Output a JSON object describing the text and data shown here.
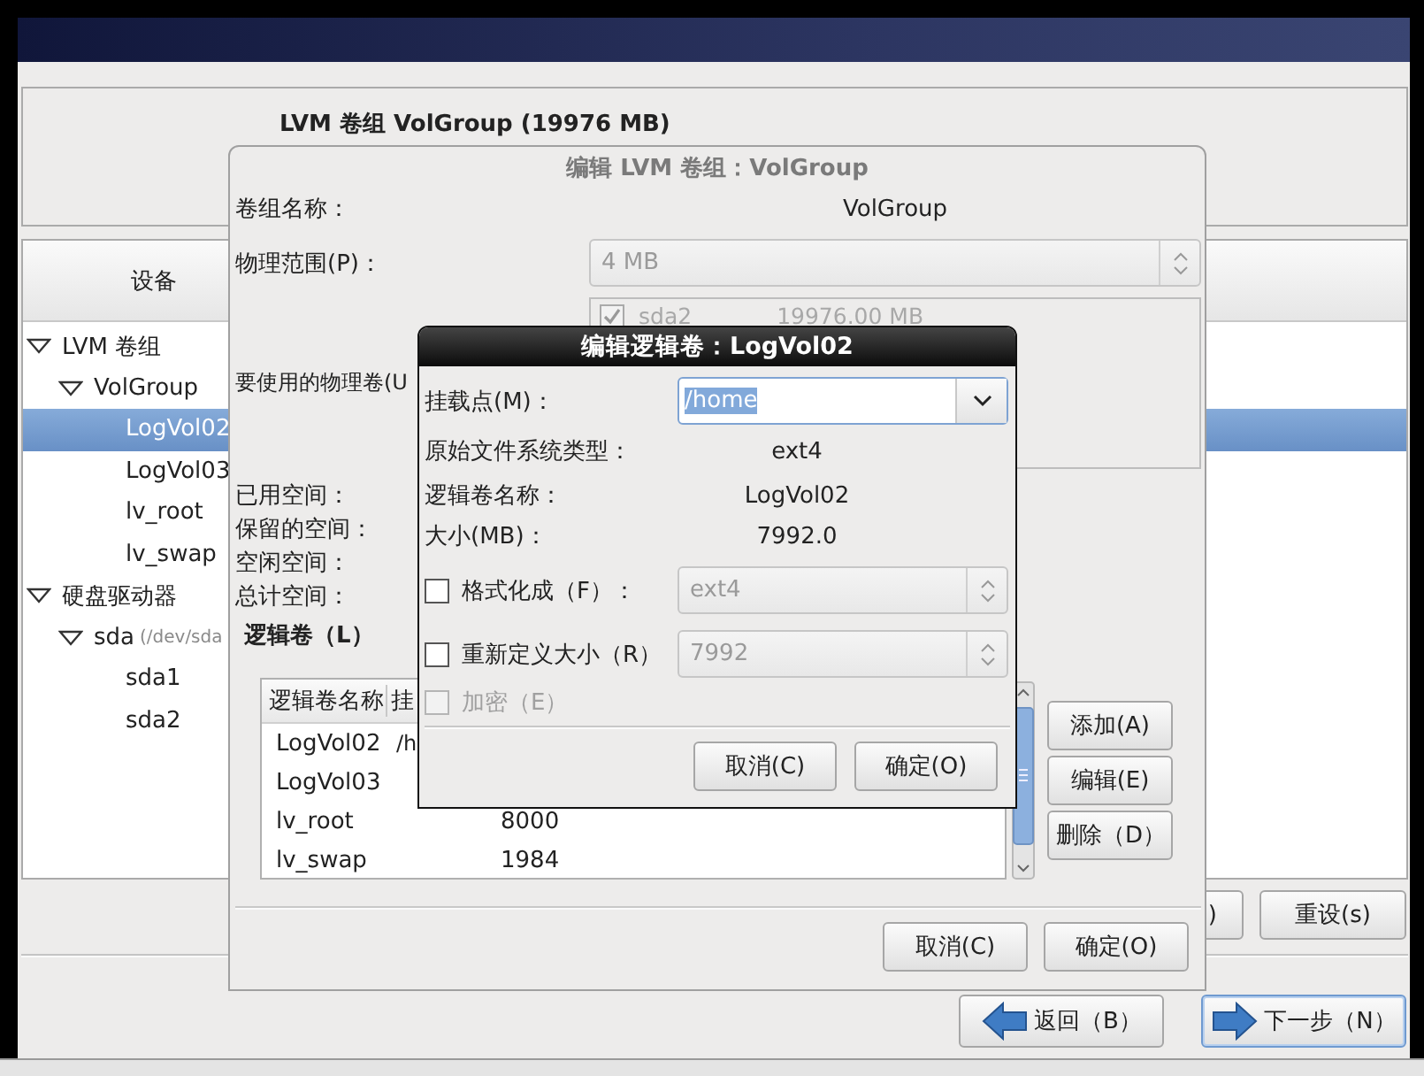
{
  "volume_group": {
    "heading": "LVM 卷组 VolGroup (19976 MB)"
  },
  "devices": {
    "header": "设备",
    "tree": [
      {
        "name": "LVM 卷组",
        "selected": false,
        "expanded": true,
        "children": [
          {
            "name": "VolGroup",
            "selected": false,
            "expanded": true,
            "children": [
              {
                "name": "LogVol02",
                "selected": true
              },
              {
                "name": "LogVol03",
                "selected": false
              },
              {
                "name": "lv_root",
                "selected": false
              },
              {
                "name": "lv_swap",
                "selected": false
              }
            ]
          }
        ]
      },
      {
        "name": "硬盘驱动器",
        "selected": false,
        "expanded": true,
        "children": [
          {
            "name": "sda",
            "detail": "(/dev/sda",
            "selected": false,
            "expanded": true,
            "children": [
              {
                "name": "sda1",
                "selected": false
              },
              {
                "name": "sda2",
                "selected": false
              }
            ]
          }
        ]
      }
    ]
  },
  "main_buttons": [
    ")",
    "重设(s)"
  ],
  "navigation": [
    {
      "label": "返回（B）",
      "kind": "back",
      "focused": false
    },
    {
      "label": "下一步（N）",
      "kind": "next",
      "focused": true
    }
  ],
  "volume_group_dialog": {
    "title": "编辑 LVM 卷组：VolGroup",
    "name_label": "卷组名称：",
    "name_value": "VolGroup",
    "extent_label": "物理范围(P)：",
    "extent_value": "4 MB",
    "pv_label": "要使用的物理卷(U",
    "pvs": [
      {
        "name": "sda2",
        "size": "19976.00 MB",
        "checked": true
      }
    ],
    "space_labels": [
      "已用空间：",
      "保留的空间：",
      "空闲空间：",
      "总计空间："
    ],
    "lv_heading": "逻辑卷（L）",
    "lv_table": {
      "columns": [
        "逻辑卷名称",
        "挂"
      ],
      "rows": [
        {
          "name": "LogVol02",
          "mount": "/h"
        },
        {
          "name": "LogVol03"
        },
        {
          "name": "lv_root",
          "size": "8000"
        },
        {
          "name": "lv_swap",
          "size": "1984"
        }
      ]
    },
    "side_buttons": [
      "添加(A)",
      "编辑(E)",
      "删除（D）"
    ],
    "buttons": [
      "取消(C)",
      "确定(O)"
    ]
  },
  "logical_volume_dialog": {
    "title": "编辑逻辑卷：LogVol02",
    "mount_label": "挂载点(M)：",
    "mount_value": "/home",
    "info": [
      {
        "label": "原始文件系统类型：",
        "value": "ext4"
      },
      {
        "label": "逻辑卷名称：",
        "value": "LogVol02"
      },
      {
        "label": "大小(MB)：",
        "value": "7992.0"
      }
    ],
    "options": [
      {
        "label": "格式化成（F）：",
        "kind": "combo",
        "checked": false,
        "disabled": false,
        "value": "ext4"
      },
      {
        "label": "重新定义大小（R）",
        "kind": "spin",
        "checked": false,
        "disabled": false,
        "value": "7992"
      },
      {
        "label": "加密（E）",
        "kind": "plain",
        "checked": false,
        "disabled": true
      }
    ],
    "buttons": [
      "取消(C)",
      "确定(O)"
    ]
  }
}
